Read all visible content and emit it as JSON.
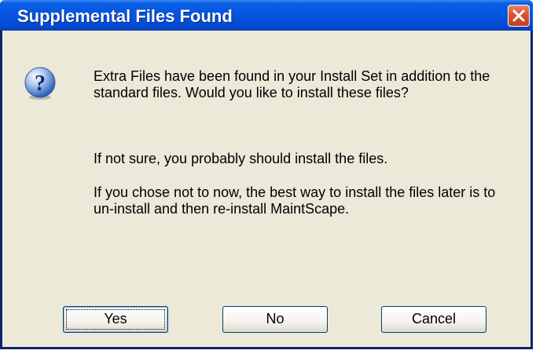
{
  "window": {
    "title": "Supplemental Files Found",
    "close_icon": "close-icon"
  },
  "message": {
    "icon": "question-icon",
    "paragraph_1": "Extra Files have been found in your Install Set in addition to the standard files.  Would you like to install these files?",
    "paragraph_2": "If not sure, you probably should install the files.",
    "paragraph_3": "If you chose not to now, the best way to install the files later is to un-install and then re-install MaintScape."
  },
  "buttons": {
    "yes": "Yes",
    "no": "No",
    "cancel": "Cancel"
  },
  "colors": {
    "titlebar": "#0554de",
    "client": "#ece9d8",
    "close": "#d8552f"
  }
}
